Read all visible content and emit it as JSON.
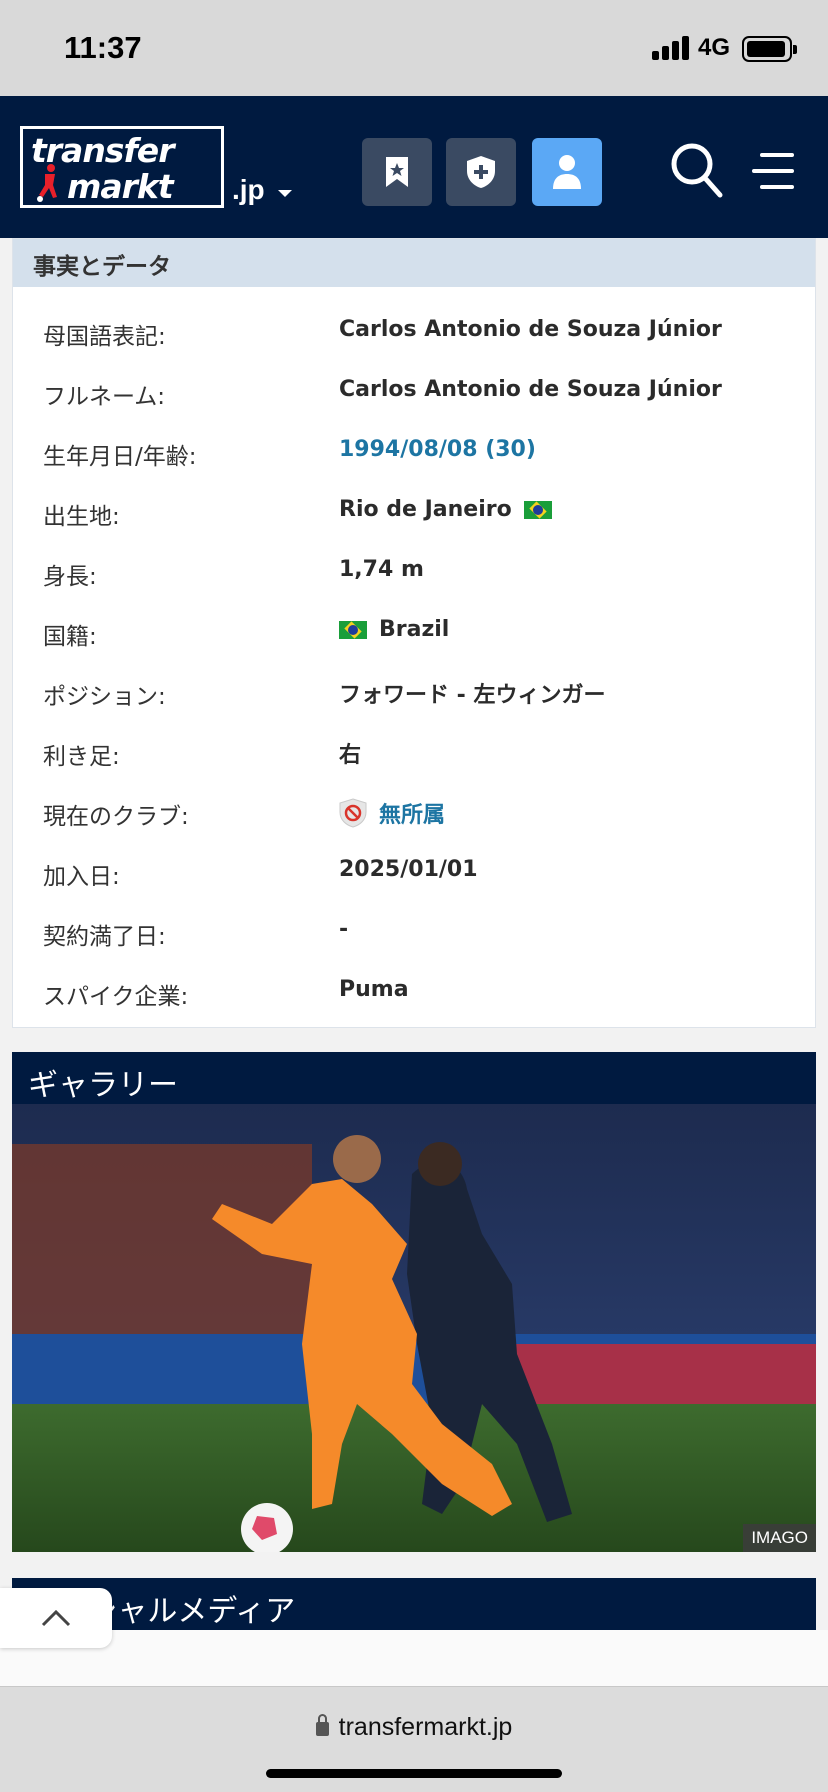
{
  "status": {
    "time": "11:37",
    "network": "4G"
  },
  "header": {
    "logo_line1": "transfer",
    "logo_line2": "markt",
    "domain": ".jp",
    "buttons": [
      "bookmark-icon",
      "shield-plus-icon",
      "user-icon"
    ],
    "search_icon": "search-icon",
    "menu_icon": "menu-icon"
  },
  "facts": {
    "title": "事実とデータ",
    "rows": [
      {
        "label": "母国語表記:",
        "value": "Carlos Antonio de Souza Júnior"
      },
      {
        "label": "フルネーム:",
        "value": "Carlos Antonio de Souza Júnior"
      },
      {
        "label": "生年月日/年齢:",
        "value": "1994/08/08 (30)"
      },
      {
        "label": "出生地:",
        "value": "Rio de Janeiro"
      },
      {
        "label": "身長:",
        "value": "1,74 m"
      },
      {
        "label": "国籍:",
        "value": "Brazil"
      },
      {
        "label": "ポジション:",
        "value": "フォワード - 左ウィンガー"
      },
      {
        "label": "利き足:",
        "value": "右"
      },
      {
        "label": "現在のクラブ:",
        "value": "無所属"
      },
      {
        "label": "加入日:",
        "value": "2025/01/01"
      },
      {
        "label": "契約満了日:",
        "value": "-"
      },
      {
        "label": "スパイク企業:",
        "value": "Puma"
      }
    ]
  },
  "gallery": {
    "title": "ギャラリー",
    "credit": "IMAGO"
  },
  "social": {
    "title": "ソーシャルメディア"
  },
  "browser": {
    "url": "transfermarkt.jp"
  },
  "colors": {
    "navy": "#001a40",
    "link": "#1d75a3",
    "active_button": "#5ba8f5"
  }
}
